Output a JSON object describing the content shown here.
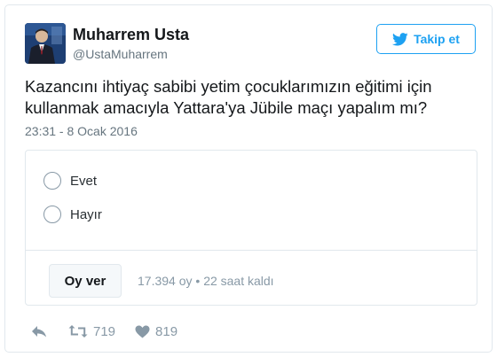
{
  "author": {
    "name": "Muharrem Usta",
    "handle": "@UstaMuharrem"
  },
  "follow_button": {
    "label": "Takip et",
    "icon": "twitter-bird-icon",
    "color": "#1da1f2"
  },
  "tweet": {
    "text_line_1": "Kazancını ihtiyaç sabibi yetim çocuklarımızın eğitimi için",
    "text_line_2": "kullanmak amacıyla Yattara'ya Jübile maçı yapalım mı?",
    "timestamp": "23:31 - 8 Ocak 2016"
  },
  "poll": {
    "options": [
      {
        "label": "Evet"
      },
      {
        "label": "Hayır"
      }
    ],
    "vote_label": "Oy ver",
    "votes": "17.394 oy",
    "separator": "•",
    "time_left": "22 saat kaldı"
  },
  "actions": {
    "reply_icon": "reply-icon",
    "retweet_icon": "retweet-icon",
    "retweet_count": "719",
    "like_icon": "heart-icon",
    "like_count": "819"
  }
}
